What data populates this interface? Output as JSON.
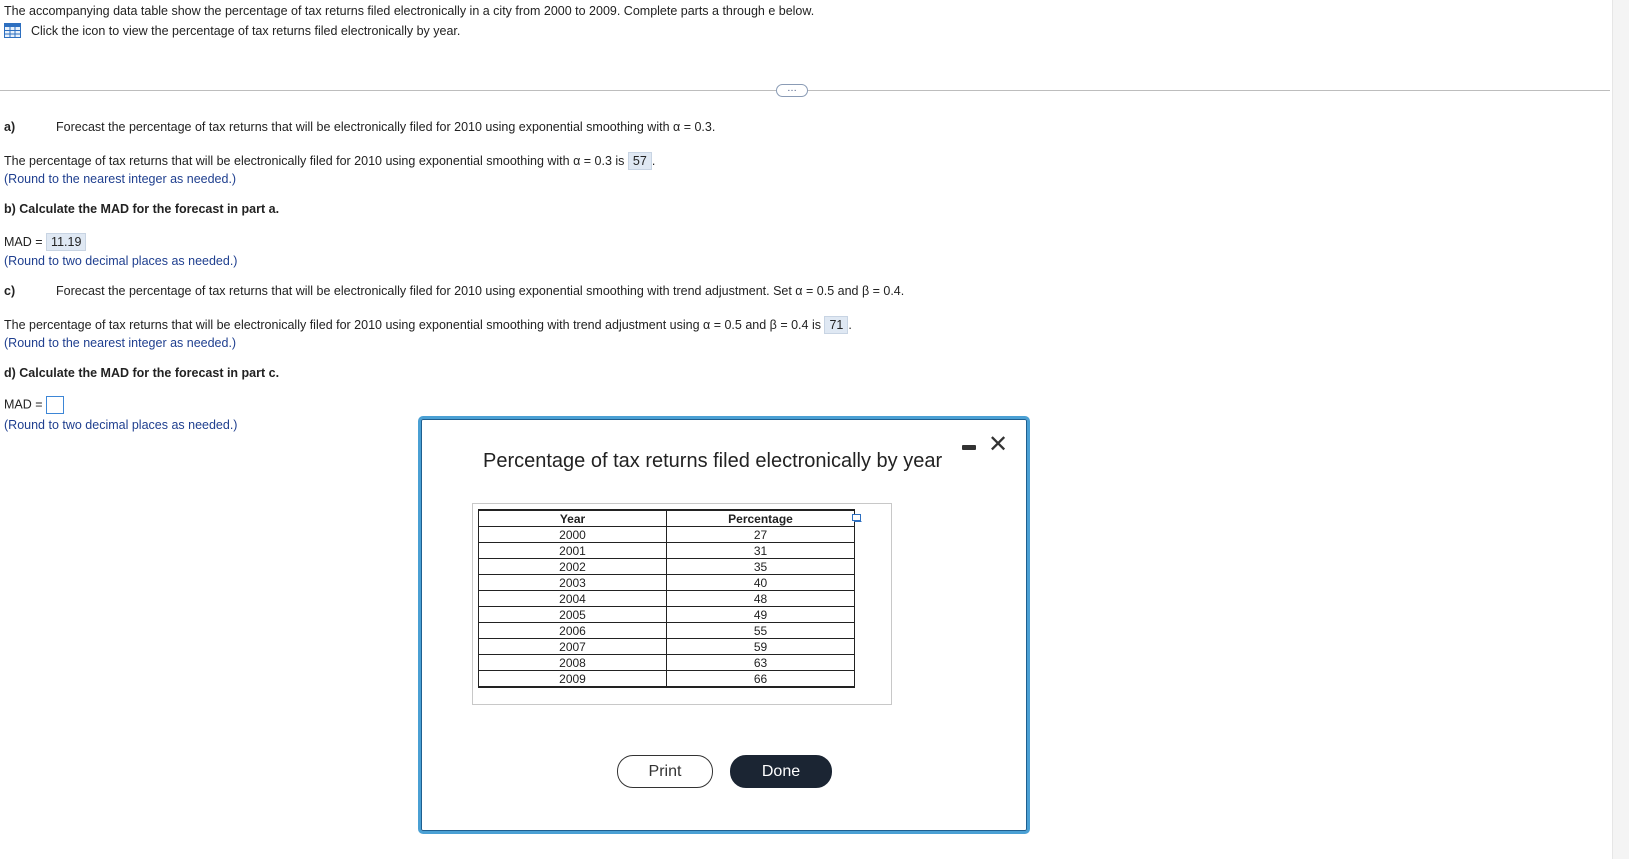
{
  "intro": {
    "line1": "The accompanying data table show the percentage of tax returns filed electronically in a city from 2000 to 2009. Complete parts a through e below.",
    "line2": "Click the icon to view the percentage of tax returns filed electronically by year."
  },
  "expander_label": "…",
  "part_a": {
    "label": "a)",
    "prompt": "Forecast the percentage of tax returns that will be electronically filed for 2010 using exponential smoothing with α = 0.3.",
    "statement": "The percentage of tax returns that will be electronically filed for 2010 using exponential smoothing with α = 0.3 is",
    "answer": "57",
    "hint": "(Round to the nearest integer as needed.)"
  },
  "part_b": {
    "prompt": "b) Calculate the MAD for the forecast in part a.",
    "mad_label": "MAD =",
    "answer": "11.19",
    "hint": "(Round to two decimal places as needed.)"
  },
  "part_c": {
    "label": "c)",
    "prompt": "Forecast the percentage of tax returns that will be electronically filed for 2010 using exponential smoothing with trend adjustment. Set α = 0.5 and β = 0.4.",
    "statement": "The percentage of tax returns that will be electronically filed for 2010 using exponential smoothing with trend adjustment using α = 0.5 and β = 0.4 is",
    "answer": "71",
    "hint": "(Round to the nearest integer as needed.)"
  },
  "part_d": {
    "prompt": "d) Calculate the MAD for the forecast in part c.",
    "mad_label": "MAD =",
    "answer": "",
    "hint": "(Round to two decimal places as needed.)"
  },
  "modal": {
    "title": "Percentage of tax returns filed electronically by year",
    "columns": [
      "Year",
      "Percentage"
    ],
    "rows": [
      [
        "2000",
        "27"
      ],
      [
        "2001",
        "31"
      ],
      [
        "2002",
        "35"
      ],
      [
        "2003",
        "40"
      ],
      [
        "2004",
        "48"
      ],
      [
        "2005",
        "49"
      ],
      [
        "2006",
        "55"
      ],
      [
        "2007",
        "59"
      ],
      [
        "2008",
        "63"
      ],
      [
        "2009",
        "66"
      ]
    ],
    "print_label": "Print",
    "done_label": "Done",
    "close_glyph": "✕"
  },
  "colors": {
    "answer_bg": "#dfe8f3",
    "hint_text": "#1f3f8f",
    "modal_border": "#4aa0d4",
    "done_bg": "#1b2533"
  }
}
